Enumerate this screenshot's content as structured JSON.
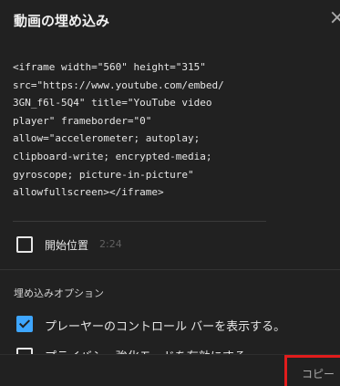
{
  "dialog": {
    "title": "動画の埋め込み",
    "close_icon": "×"
  },
  "embed": {
    "code": "<iframe width=\"560\" height=\"315\"\nsrc=\"https://www.youtube.com/embed/\n3GN_f6l-5Q4\" title=\"YouTube video\nplayer\" frameborder=\"0\"\nallow=\"accelerometer; autoplay;\nclipboard-write; encrypted-media;\ngyroscope; picture-in-picture\"\nallowfullscreen></iframe>"
  },
  "start_position": {
    "label": "開始位置",
    "time": "2:24",
    "checked": false
  },
  "options": {
    "section_label": "埋め込みオプション",
    "items": [
      {
        "label": "プレーヤーのコントロール バーを表示する。",
        "checked": true
      },
      {
        "label": "プライバシー強化モードを有効にする。",
        "checked": false
      }
    ]
  },
  "footer": {
    "copy_label": "コピー"
  },
  "colors": {
    "background": "#212121",
    "accent": "#3ea6ff",
    "highlight": "#e11c1c"
  }
}
